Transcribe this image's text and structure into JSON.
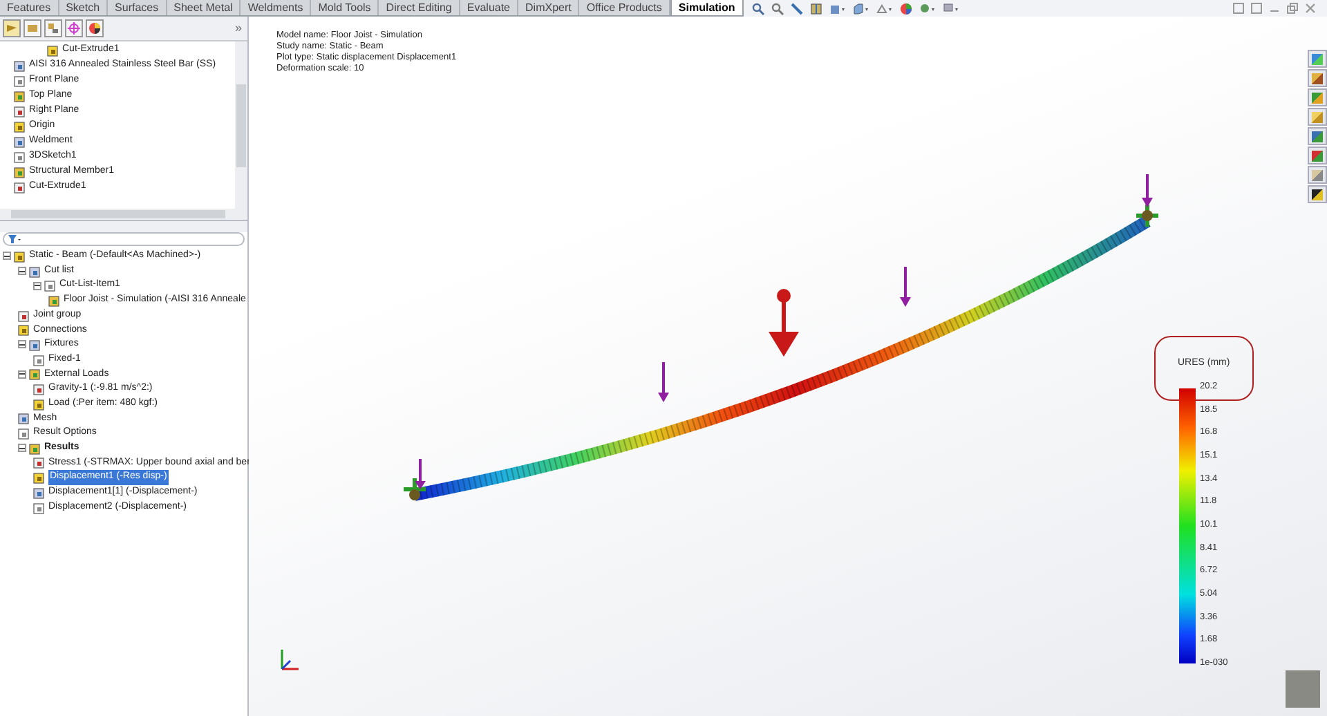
{
  "tabs": [
    {
      "label": "Features",
      "selected": false
    },
    {
      "label": "Sketch",
      "selected": false
    },
    {
      "label": "Surfaces",
      "selected": false
    },
    {
      "label": "Sheet Metal",
      "selected": false
    },
    {
      "label": "Weldments",
      "selected": false
    },
    {
      "label": "Mold Tools",
      "selected": false
    },
    {
      "label": "Direct Editing",
      "selected": false
    },
    {
      "label": "Evaluate",
      "selected": false
    },
    {
      "label": "DimXpert",
      "selected": false
    },
    {
      "label": "Office Products",
      "selected": false
    },
    {
      "label": "Simulation",
      "selected": true
    }
  ],
  "panel_toggle": "»",
  "feature_tree": [
    {
      "label": "Cut-Extrude1"
    },
    {
      "label": "AISI 316 Annealed Stainless Steel Bar (SS)"
    },
    {
      "label": "Front Plane"
    },
    {
      "label": "Top Plane"
    },
    {
      "label": "Right Plane"
    },
    {
      "label": "Origin"
    },
    {
      "label": "Weldment"
    },
    {
      "label": "3DSketch1"
    },
    {
      "label": "Structural Member1"
    },
    {
      "label": "Cut-Extrude1"
    }
  ],
  "study_tree": {
    "label": "Static - Beam (-Default<As Machined>-)",
    "selected": false,
    "children": [
      {
        "label": "Cut list",
        "selected": false,
        "children": [
          {
            "label": "Cut-List-Item1",
            "selected": false,
            "children": [
              {
                "label": "Floor Joist - Simulation (-AISI 316 Anneale",
                "selected": false
              }
            ]
          }
        ]
      },
      {
        "label": "Joint group",
        "selected": false
      },
      {
        "label": "Connections",
        "selected": false
      },
      {
        "label": "Fixtures",
        "selected": false,
        "children": [
          {
            "label": "Fixed-1",
            "selected": false
          }
        ]
      },
      {
        "label": "External Loads",
        "selected": false,
        "children": [
          {
            "label": "Gravity-1 (:-9.81 m/s^2:)",
            "selected": false
          },
          {
            "label": "Load (:Per item: 480 kgf:)",
            "selected": false
          }
        ]
      },
      {
        "label": "Mesh",
        "selected": false
      },
      {
        "label": "Result Options",
        "selected": false
      },
      {
        "label": "Results",
        "selected": false,
        "children": [
          {
            "label": "Stress1 (-STRMAX: Upper bound axial and ber",
            "selected": false
          },
          {
            "label": "Displacement1 (-Res disp-)",
            "selected": true
          },
          {
            "label": "Displacement1[1] (-Displacement-)",
            "selected": false
          },
          {
            "label": "Displacement2 (-Displacement-)",
            "selected": false
          }
        ]
      }
    ]
  },
  "plot_info": [
    "Model name: Floor Joist - Simulation",
    "Study name: Static - Beam",
    "Plot type: Static displacement Displacement1",
    "Deformation scale: 10"
  ],
  "legend": {
    "title": "URES (mm)",
    "ticks": [
      "20.2",
      "18.5",
      "16.8",
      "15.1",
      "13.4",
      "11.8",
      "10.1",
      "8.41",
      "6.72",
      "5.04",
      "3.36",
      "1.68",
      "1e-030"
    ]
  }
}
